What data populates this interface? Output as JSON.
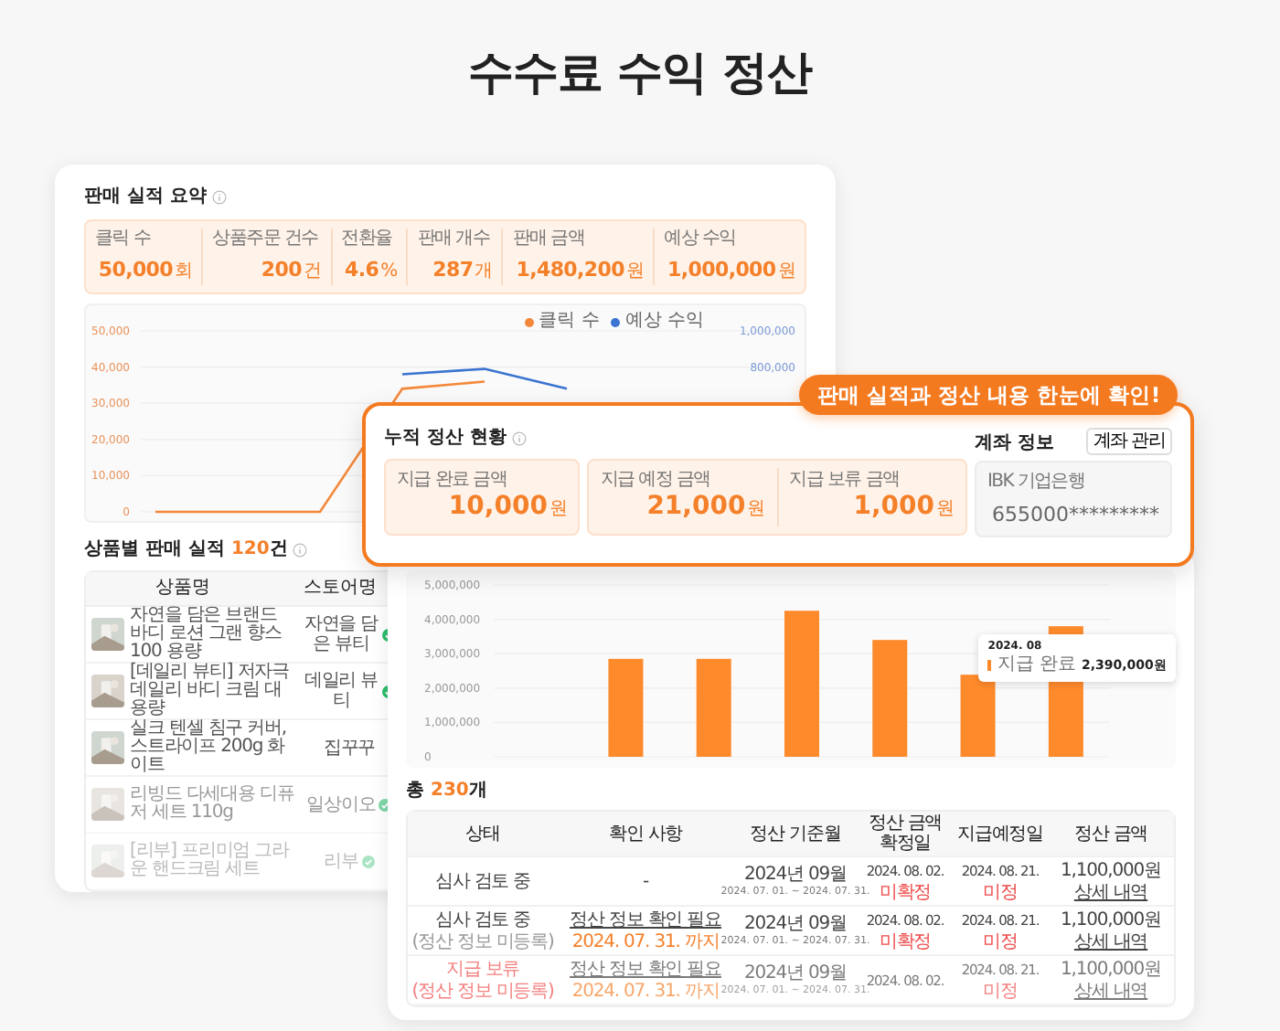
{
  "title": "수수료 수익 정산",
  "sales_summary": {
    "title": "판매 실적 요약",
    "kpis": [
      {
        "label": "클릭 수",
        "value": "50,000",
        "unit": "회"
      },
      {
        "label": "상품주문 건수",
        "value": "200",
        "unit": "건"
      },
      {
        "label": "전환율",
        "value": "4.6",
        "unit": "%"
      },
      {
        "label": "판매 개수",
        "value": "287",
        "unit": "개"
      },
      {
        "label": "판매 금액",
        "value": "1,480,200",
        "unit": "원"
      },
      {
        "label": "예상 수익",
        "value": "1,000,000",
        "unit": "원"
      }
    ],
    "right_axis_labels": [
      "1,000,000",
      "800,000"
    ],
    "chart_data": {
      "type": "line",
      "ylim": [
        0,
        50000
      ],
      "grid": true,
      "legend": true,
      "yticks": [
        {
          "value": 0,
          "label": "0"
        },
        {
          "value": 10000,
          "label": "10,000"
        },
        {
          "value": 20000,
          "label": "20,000"
        },
        {
          "value": 30000,
          "label": "30,000"
        },
        {
          "value": 40000,
          "label": "40,000"
        },
        {
          "value": 50000,
          "label": "50,000"
        }
      ],
      "series": [
        {
          "name": "클릭 수",
          "color": "#f4883a",
          "values": [
            0,
            0,
            0,
            34000,
            36000,
            null
          ]
        },
        {
          "name": "예상 수익",
          "color": "#3b74d1",
          "values": [
            null,
            null,
            null,
            38000,
            39500,
            34000
          ]
        }
      ]
    }
  },
  "product_sales": {
    "title": "상품별 판매 실적",
    "count": "120",
    "suffix": "건",
    "columns": [
      "상품명",
      "스토어명"
    ],
    "rows": [
      {
        "product": "자연을 담은 브랜드 바디 로션 그랜 향스 100 용량",
        "store": "자연을 담은 뷰티",
        "verified": true
      },
      {
        "product": "[데일리 뷰티] 저자극 데일리 바디 크림 대용량",
        "store": "데일리 뷰티",
        "verified": true
      },
      {
        "product": "실크 텐셀 침구 커버, 스트라이프 200g 화이트",
        "store": "집꾸꾸",
        "verified": false
      },
      {
        "product": "리빙드 다세대용 디퓨저 세트 110g",
        "store": "일상이오",
        "verified": true
      },
      {
        "product": "[리부] 프리미엄 그라운 핸드크림 세트",
        "store": "리부",
        "verified": true
      }
    ]
  },
  "settlement_chart": {
    "chart_data": {
      "type": "bar",
      "ylim": [
        0,
        5000000
      ],
      "grid": true,
      "yticks": [
        {
          "value": 0,
          "label": "0"
        },
        {
          "value": 1000000,
          "label": "1,000,000"
        },
        {
          "value": 2000000,
          "label": "2,000,000"
        },
        {
          "value": 3000000,
          "label": "3,000,000"
        },
        {
          "value": 4000000,
          "label": "4,000,000"
        },
        {
          "value": 5000000,
          "label": "5,000,000"
        }
      ],
      "values": [
        null,
        2850000,
        2850000,
        4250000,
        3400000,
        2390000,
        3800000
      ]
    },
    "tooltip": {
      "title": "2024. 08",
      "label": "지급 완료",
      "value": "2,390,000원"
    }
  },
  "settlement_list": {
    "prefix": "총",
    "count": "230",
    "suffix": "개",
    "columns": [
      "상태",
      "확인 사항",
      "정산 기준월",
      "정산 금액 확정일",
      "지급예정일",
      "정산 금액"
    ],
    "rows": [
      {
        "status": "심사 검토 중",
        "alert": false,
        "check": "-",
        "month": "2024년 09월",
        "period": "2024. 07. 01. ~ 2024. 07. 31.",
        "confirm_date": "2024. 08. 02.",
        "confirm_note": "미확정",
        "pay_date": "2024. 08. 21.",
        "pay_note": "미정",
        "amount": "1,100,000원",
        "detail": "상세 내역"
      },
      {
        "status": "심사 검토 중",
        "status_note": "(정산 정보 미등록)",
        "alert": false,
        "check": "정산 정보 확인 필요",
        "check_due": "2024. 07. 31. 까지",
        "month": "2024년 09월",
        "period": "2024. 07. 01. ~ 2024. 07. 31.",
        "confirm_date": "2024. 08. 02.",
        "confirm_note": "미확정",
        "pay_date": "2024. 08. 21.",
        "pay_note": "미정",
        "amount": "1,100,000원",
        "detail": "상세 내역"
      },
      {
        "status": "지급 보류",
        "status_note": "(정산 정보 미등록)",
        "alert": true,
        "check": "정산 정보 확인 필요",
        "check_due": "2024. 07. 31. 까지",
        "month": "2024년 09월",
        "period": "2024. 07. 01. ~ 2024. 07. 31.",
        "confirm_date": "2024. 08. 02.",
        "pay_date": "2024. 08. 21.",
        "pay_note": "미정",
        "amount": "1,100,000원",
        "detail": "상세 내역"
      }
    ]
  },
  "accumulated": {
    "title": "누적 정산 현황",
    "amounts": [
      {
        "label": "지급 완료 금액",
        "value": "10,000",
        "unit": "원"
      },
      {
        "label": "지급 예정 금액",
        "value": "21,000",
        "unit": "원"
      },
      {
        "label": "지급 보류 금액",
        "value": "1,000",
        "unit": "원"
      }
    ]
  },
  "account": {
    "title": "계좌 정보",
    "button": "계좌 관리",
    "bank": "IBK 기업은행",
    "number": "655000*********"
  },
  "callout": "판매 실적과 정산 내용 한눈에 확인!"
}
